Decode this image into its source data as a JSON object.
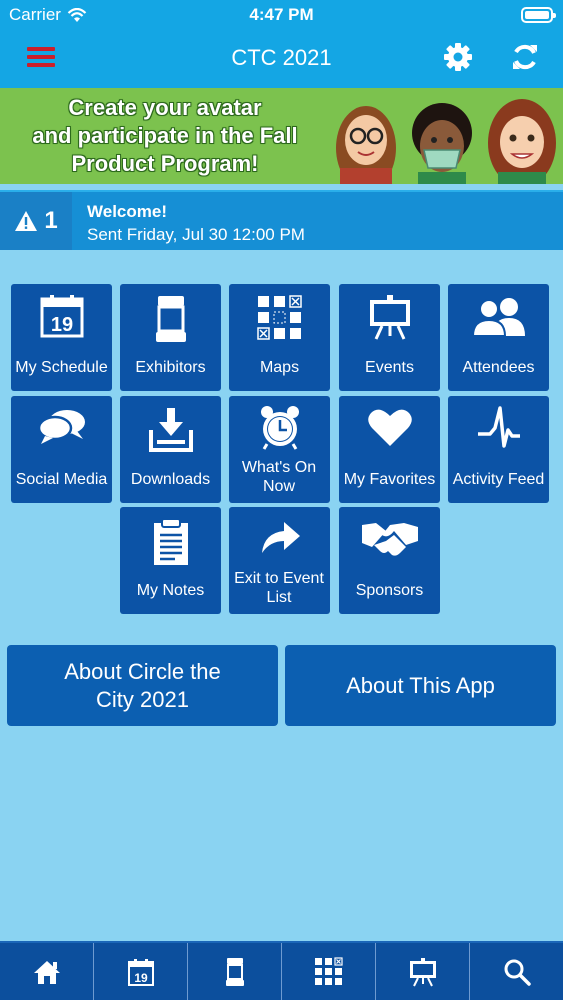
{
  "status": {
    "carrier": "Carrier",
    "time": "4:47 PM"
  },
  "nav": {
    "title": "CTC 2021"
  },
  "banner": {
    "lines": [
      "Create your avatar",
      "and participate in the Fall",
      "Product Program!"
    ]
  },
  "notification": {
    "count": "1",
    "title": "Welcome!",
    "subtitle": "Sent Friday, Jul 30 12:00 PM"
  },
  "tiles": [
    {
      "label": "My Schedule",
      "icon": "calendar-icon"
    },
    {
      "label": "Exhibitors",
      "icon": "booth-icon"
    },
    {
      "label": "Maps",
      "icon": "map-grid-icon"
    },
    {
      "label": "Events",
      "icon": "easel-icon"
    },
    {
      "label": "Attendees",
      "icon": "people-icon"
    },
    {
      "label": "Social Media",
      "icon": "chat-bubbles-icon"
    },
    {
      "label": "Downloads",
      "icon": "download-icon"
    },
    {
      "label": "What's On Now",
      "icon": "alarm-clock-icon"
    },
    {
      "label": "My Favorites",
      "icon": "heart-icon"
    },
    {
      "label": "Activity Feed",
      "icon": "pulse-icon"
    },
    {
      "label": "My Notes",
      "icon": "notepad-icon"
    },
    {
      "label": "Exit to Event List",
      "icon": "share-arrow-icon"
    },
    {
      "label": "Sponsors",
      "icon": "handshake-icon"
    }
  ],
  "calendar_day": "19",
  "buttons": {
    "about_event": "About Circle the City 2021",
    "about_app": "About This App"
  },
  "tabbar": [
    "home-icon",
    "calendar-icon",
    "booth-icon",
    "map-grid-icon",
    "easel-icon",
    "search-icon"
  ],
  "colors": {
    "nav_bg": "#14a6e4",
    "page_bg": "#8ad3f2",
    "tile_bg": "#0c53a6",
    "menu_red": "#cc1f2b",
    "banner_green": "#7cc24e"
  }
}
